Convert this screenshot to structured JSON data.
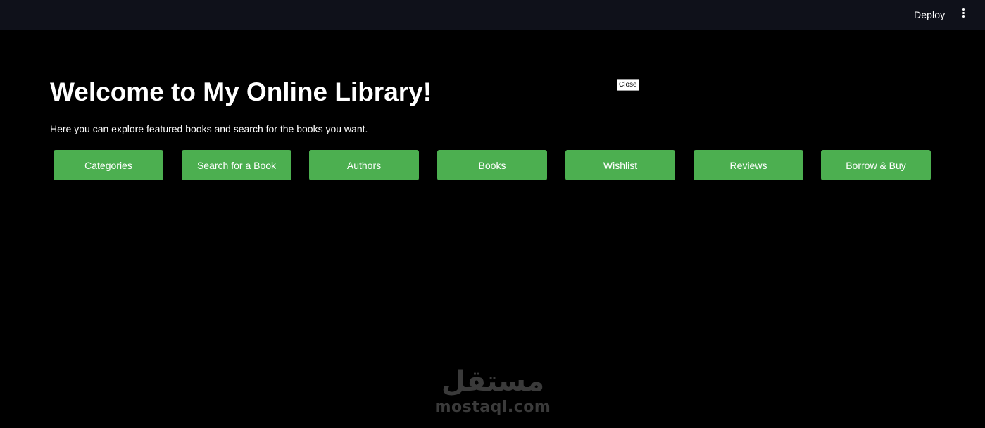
{
  "header": {
    "deploy_label": "Deploy",
    "menu_icon": "kebab-menu-icon"
  },
  "main": {
    "title": "Welcome to My Online Library!",
    "subtitle": "Here you can explore featured books and search for the books you want.",
    "close_tooltip": "Close"
  },
  "nav": {
    "buttons": [
      {
        "label": "Categories"
      },
      {
        "label": "Search for a Book"
      },
      {
        "label": "Authors"
      },
      {
        "label": "Books"
      },
      {
        "label": "Wishlist"
      },
      {
        "label": "Reviews"
      },
      {
        "label": "Borrow & Buy"
      }
    ]
  },
  "watermark": {
    "arabic": "مستقل",
    "latin": "mostaql.com"
  },
  "colors": {
    "background": "#000000",
    "topbar": "#0f111a",
    "button": "#4caf50",
    "text": "#ffffff"
  }
}
